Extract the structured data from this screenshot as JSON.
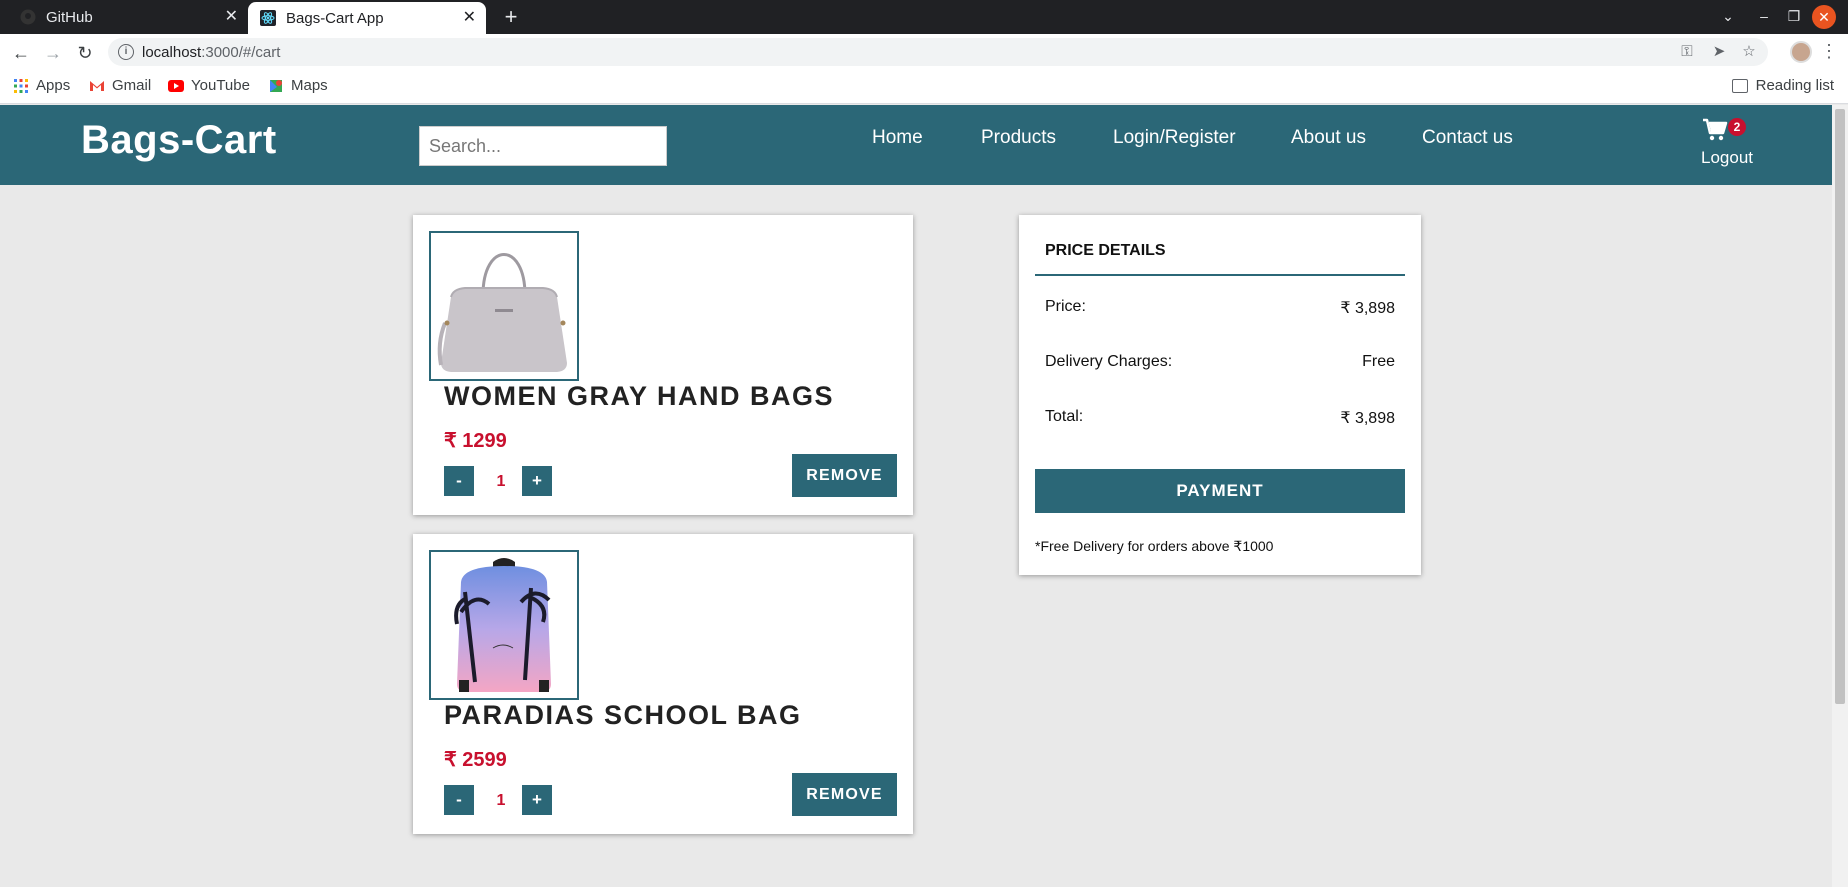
{
  "browser": {
    "tabs": [
      {
        "title": "GitHub",
        "icon": "github-icon",
        "active": false
      },
      {
        "title": "Bags-Cart App",
        "icon": "react-icon",
        "active": true
      }
    ],
    "url_host": "localhost",
    "url_rest": ":3000/#/cart",
    "bookmarks": [
      {
        "label": "Apps",
        "icon": "apps-grid-icon"
      },
      {
        "label": "Gmail",
        "icon": "gmail-icon"
      },
      {
        "label": "YouTube",
        "icon": "youtube-icon"
      },
      {
        "label": "Maps",
        "icon": "maps-icon"
      }
    ],
    "reading_list": "Reading list"
  },
  "header": {
    "brand": "Bags-Cart",
    "search_placeholder": "Search...",
    "nav": [
      "Home",
      "Products",
      "Login/Register",
      "About us",
      "Contact us"
    ],
    "cart_count": "2",
    "logout": "Logout",
    "color": "#2b6777"
  },
  "cart": {
    "items": [
      {
        "name": "WOMEN GRAY HAND BAGS",
        "price": "₹ 1299",
        "qty": "1",
        "minus": "-",
        "plus": "+",
        "remove": "REMOVE"
      },
      {
        "name": "PARADIAS SCHOOL BAG",
        "price": "₹ 2599",
        "qty": "1",
        "minus": "-",
        "plus": "+",
        "remove": "REMOVE"
      }
    ]
  },
  "price_details": {
    "title": "PRICE DETAILS",
    "rows": [
      {
        "label": "Price:",
        "value": "₹ 3,898"
      },
      {
        "label": "Delivery Charges:",
        "value": "Free"
      },
      {
        "label": "Total:",
        "value": "₹ 3,898"
      }
    ],
    "payment": "PAYMENT",
    "note": "*Free Delivery for orders above ₹1000"
  },
  "colors": {
    "accent": "#2b6777",
    "price": "#c8102e",
    "badge": "#c8102e"
  }
}
